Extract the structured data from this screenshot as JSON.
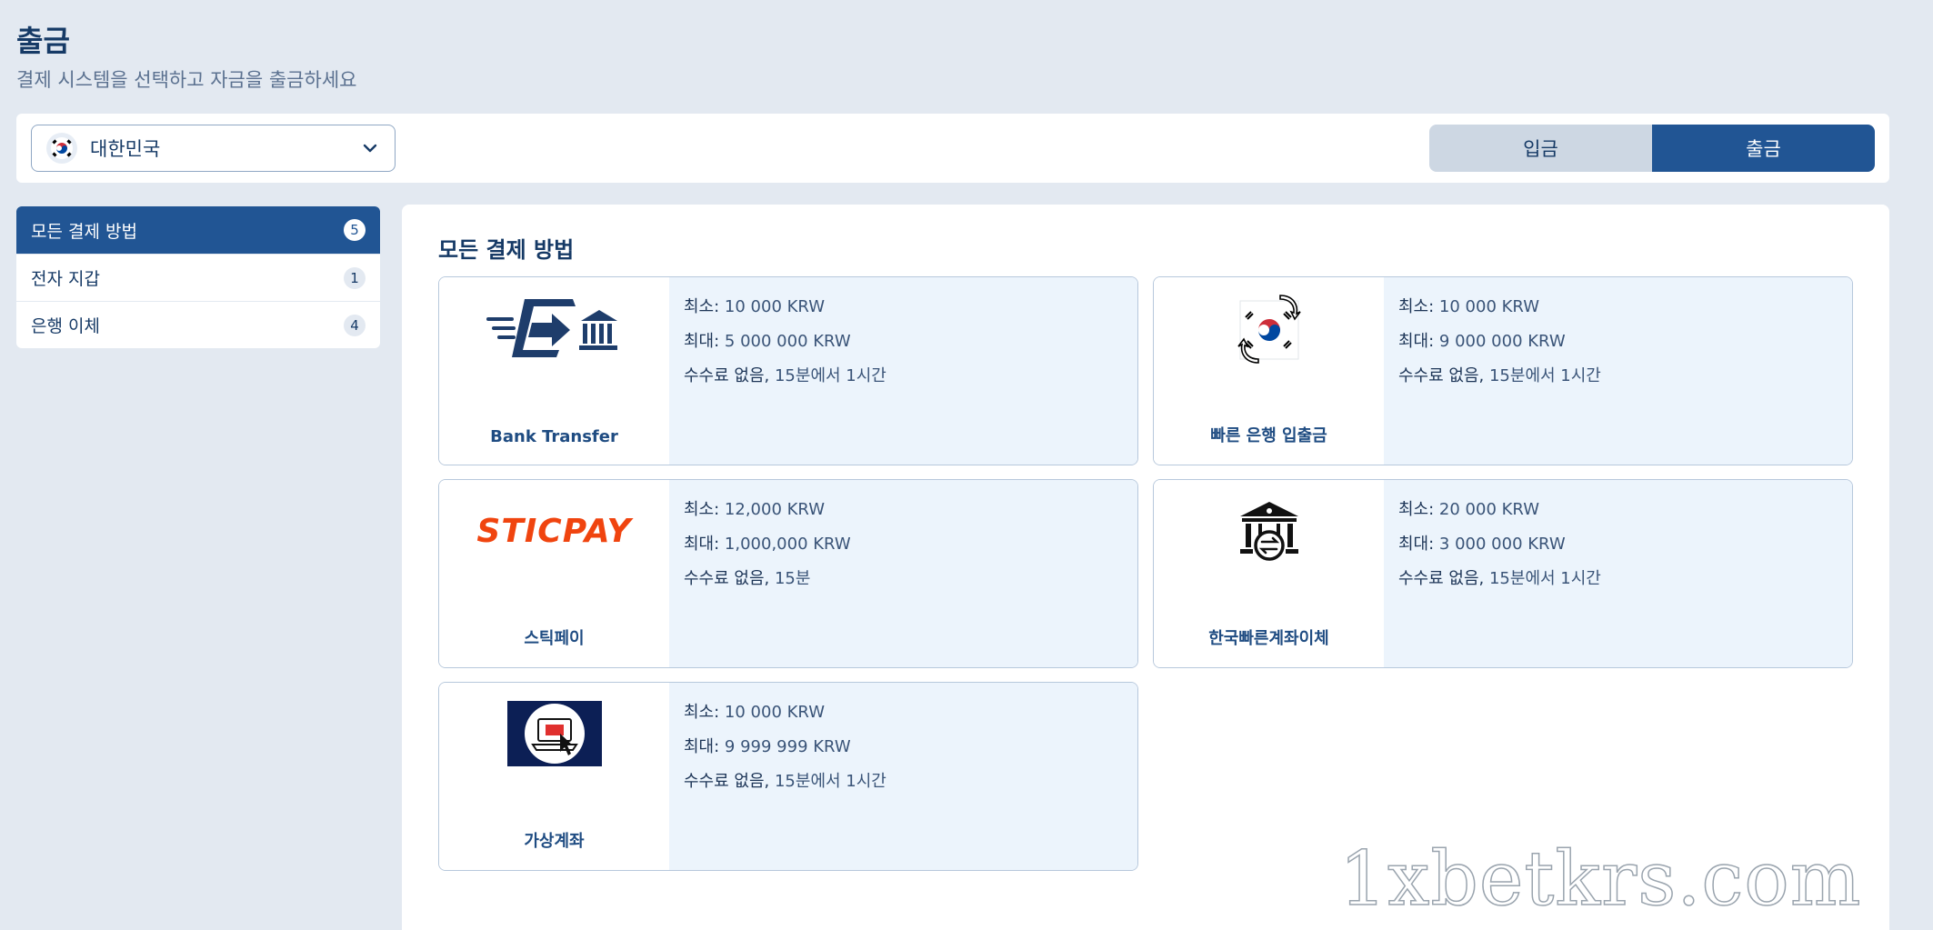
{
  "page": {
    "title": "출금",
    "subtitle": "결제 시스템을 선택하고 자금을 출금하세요"
  },
  "country_select": {
    "value": "대한민국"
  },
  "toggle": {
    "deposit_label": "입금",
    "withdraw_label": "출금",
    "active": "withdraw"
  },
  "sidebar": {
    "items": [
      {
        "label": "모든 결제 방법",
        "count": "5",
        "active": true
      },
      {
        "label": "전자 지갑",
        "count": "1",
        "active": false
      },
      {
        "label": "은행 이체",
        "count": "4",
        "active": false
      }
    ]
  },
  "main": {
    "title": "모든 결제 방법",
    "cards": [
      {
        "name": "Bank Transfer",
        "logo": "bank-transfer-icon",
        "min_label": "최소:",
        "min": "10 000 KRW",
        "max_label": "최대:",
        "max": "5 000 000 KRW",
        "fee_label": "수수료 없음,",
        "time": "15분에서 1시간"
      },
      {
        "name": "빠른 은행 입출금",
        "logo": "korea-flag-exchange-icon",
        "min_label": "최소:",
        "min": "10 000 KRW",
        "max_label": "최대:",
        "max": "9 000 000 KRW",
        "fee_label": "수수료 없음,",
        "time": "15분에서 1시간"
      },
      {
        "name": "스틱페이",
        "logo": "sticpay-logo",
        "logo_text": "STICPAY",
        "min_label": "최소:",
        "min": "12,000 KRW",
        "max_label": "최대:",
        "max": "1,000,000 KRW",
        "fee_label": "수수료 없음,",
        "time": "15분"
      },
      {
        "name": "한국빠른계좌이체",
        "logo": "bank-exchange-icon",
        "min_label": "최소:",
        "min": "20 000 KRW",
        "max_label": "최대:",
        "max": "3 000 000 KRW",
        "fee_label": "수수료 없음,",
        "time": "15분에서 1시간"
      },
      {
        "name": "가상계좌",
        "logo": "virtual-account-icon",
        "min_label": "최소:",
        "min": "10 000 KRW",
        "max_label": "최대:",
        "max": "9 999 999 KRW",
        "fee_label": "수수료 없음,",
        "time": "15분에서 1시간"
      }
    ]
  },
  "watermark": "1xbetkrs.com",
  "colors": {
    "accent": "#215594",
    "background": "#e3e9f1",
    "card_info_bg": "#ecf4fc",
    "sticpay": "#f0440f"
  }
}
